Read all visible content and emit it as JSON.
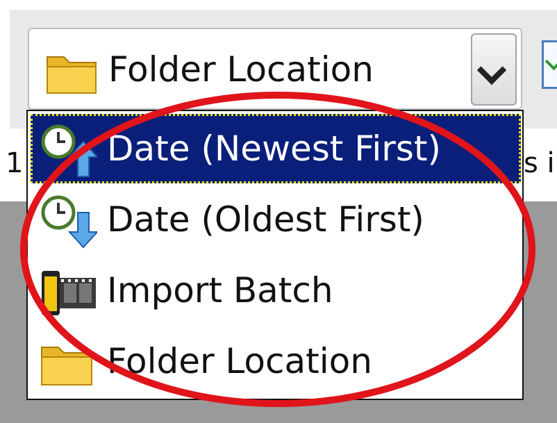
{
  "background": {
    "left_text": "1",
    "right_text": "s i"
  },
  "combo": {
    "selected_label": "Folder Location",
    "selected_icon": "folder-icon"
  },
  "dropdown": {
    "items": [
      {
        "label": "Date (Newest First)",
        "icon": "clock-up-arrow-icon",
        "selected": true
      },
      {
        "label": "Date (Oldest First)",
        "icon": "clock-down-arrow-icon",
        "selected": false
      },
      {
        "label": "Import Batch",
        "icon": "film-roll-icon",
        "selected": false
      },
      {
        "label": "Folder Location",
        "icon": "folder-icon",
        "selected": false
      }
    ]
  },
  "colors": {
    "selection_bg": "#0a1f7a",
    "annotation_ring": "#e0141b",
    "focus_dots": "#e8e000"
  }
}
